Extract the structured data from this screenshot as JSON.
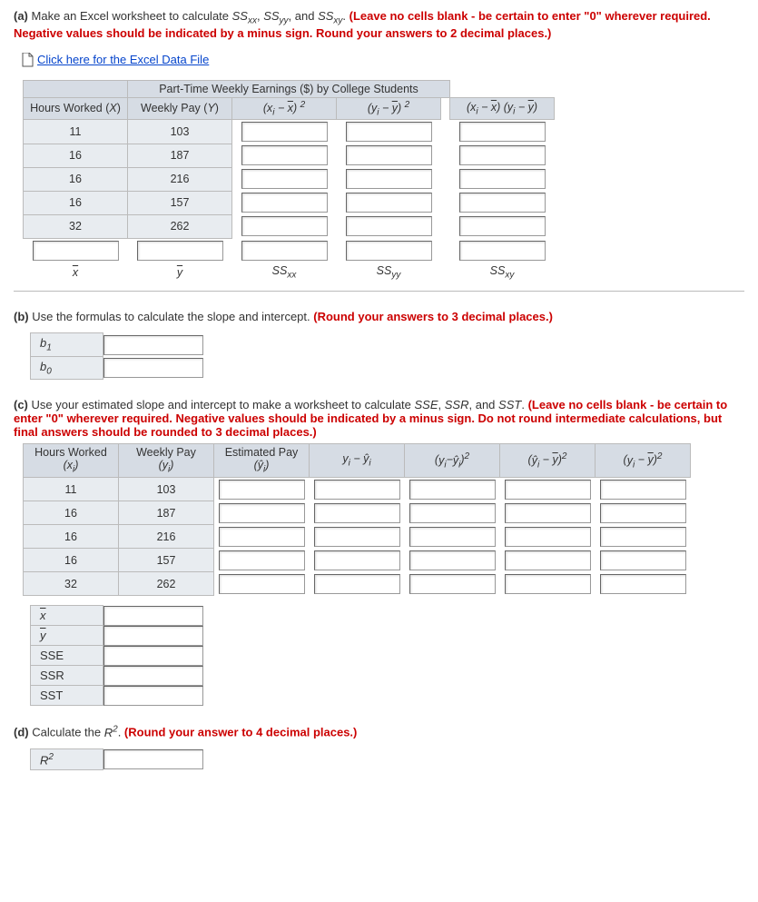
{
  "partA": {
    "label": "(a)",
    "text1": "Make an Excel worksheet to calculate ",
    "ss1": "SS",
    "ss1sub": "xx",
    "ss2": "SS",
    "ss2sub": "yy",
    "ss3": "SS",
    "ss3sub": "xy",
    "text2": ". ",
    "redText": "(Leave no cells blank - be certain to enter \"0\" wherever required. Negative values should be indicated by a minus sign. Round your answers to 2 decimal places.)",
    "linkText": "Click here for the Excel Data File"
  },
  "tableA": {
    "title": "Part-Time Weekly Earnings ($) by College Students",
    "headers": {
      "h1a": "Hours Worked (",
      "h1b": "X",
      "h1c": ")",
      "h2a": "Weekly Pay (",
      "h2b": "Y",
      "h2c": ")",
      "h3": "(xᵢ − x̄) ²",
      "h4": "(yᵢ − ȳ) ²",
      "h5": "(xᵢ − x̄) (yᵢ − ȳ)"
    },
    "rows": [
      {
        "x": "11",
        "y": "103"
      },
      {
        "x": "16",
        "y": "187"
      },
      {
        "x": "16",
        "y": "216"
      },
      {
        "x": "16",
        "y": "157"
      },
      {
        "x": "32",
        "y": "262"
      }
    ],
    "footers": {
      "f1": "x̄",
      "f2": "ȳ",
      "f3": "SS",
      "f3s": "xx",
      "f4": "SS",
      "f4s": "yy",
      "f5": "SS",
      "f5s": "xy"
    }
  },
  "partB": {
    "label": "(b)",
    "text1": "Use the formulas to calculate the slope and intercept. ",
    "redText": "(Round your answers to 3 decimal places.)",
    "b1": "b",
    "b1s": "1",
    "b0": "b",
    "b0s": "0"
  },
  "partC": {
    "label": "(c)",
    "text1": "Use your estimated slope and intercept to make a worksheet to calculate ",
    "sse": "SSE",
    "ssr": "SSR",
    "sst": "SST",
    "text2": ". ",
    "redText": "(Leave no cells blank - be certain to enter \"0\" wherever required. Negative values should be indicated by a minus sign. Do not round intermediate calculations, but final answers should be rounded to 3 decimal places.)"
  },
  "tableC": {
    "headers": {
      "h1a": "Hours Worked",
      "h1b": "(xᵢ)",
      "h2a": "Weekly Pay",
      "h2b": "(yᵢ)",
      "h3a": "Estimated Pay",
      "h3b": "(ŷᵢ)",
      "h4": "yᵢ − ŷᵢ",
      "h5": "(yᵢ−ŷᵢ) ²",
      "h6": "(ŷᵢ − ȳ) ²",
      "h7": "(yᵢ − ȳ) ²"
    },
    "rows": [
      {
        "x": "11",
        "y": "103"
      },
      {
        "x": "16",
        "y": "187"
      },
      {
        "x": "16",
        "y": "216"
      },
      {
        "x": "16",
        "y": "157"
      },
      {
        "x": "32",
        "y": "262"
      }
    ],
    "summary": {
      "xbar": "x̄",
      "ybar": "ȳ",
      "sse": "SSE",
      "ssr": "SSR",
      "sst": "SST"
    }
  },
  "partD": {
    "label": "(d)",
    "text1": "Calculate the ",
    "r2": "R",
    "r2s": "2",
    "text2": ". ",
    "redText": "(Round your answer to 4 decimal places.)"
  }
}
